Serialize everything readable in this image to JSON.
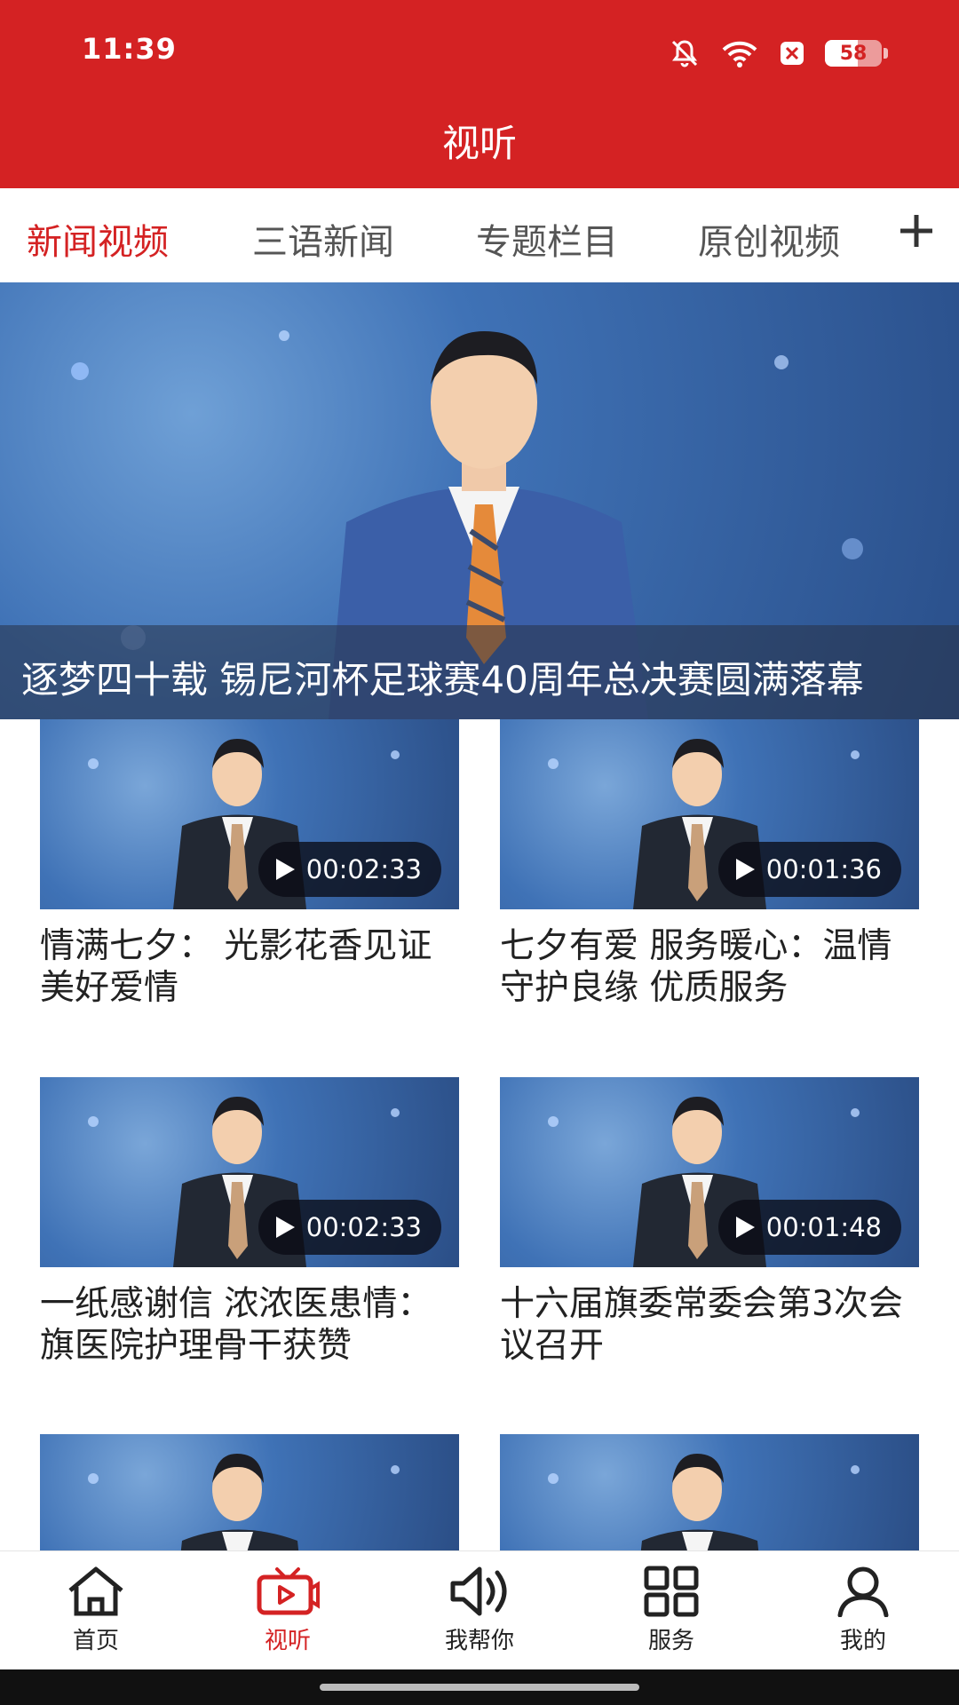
{
  "status_bar": {
    "time": "11:39",
    "battery": "58",
    "battery_level": 0.58
  },
  "header": {
    "title": "视听"
  },
  "tabs": [
    {
      "label": "新闻视频",
      "active": true
    },
    {
      "label": "三语新闻",
      "active": false
    },
    {
      "label": "专题栏目",
      "active": false
    },
    {
      "label": "原创视频",
      "active": false
    }
  ],
  "tabs_add_icon": "plus-icon",
  "hero": {
    "caption": "逐梦四十载 锡尼河杯足球赛40周年总决赛圆满落幕"
  },
  "videos": [
    {
      "title": "情满七夕： 光影花香见证美好爱情",
      "duration": "00:02:33"
    },
    {
      "title": "七夕有爱 服务暖心：温情守护良缘 优质服务",
      "duration": "00:01:36"
    },
    {
      "title": "一纸感谢信 浓浓医患情：旗医院护理骨干获赞",
      "duration": "00:02:33"
    },
    {
      "title": "十六届旗委常委会第3次会议召开",
      "duration": "00:01:48"
    },
    {
      "title": "",
      "duration": ""
    },
    {
      "title": "",
      "duration": ""
    }
  ],
  "bottom_nav": [
    {
      "label": "首页",
      "icon": "home-icon",
      "active": false
    },
    {
      "label": "视听",
      "icon": "video-tv-icon",
      "active": true
    },
    {
      "label": "我帮你",
      "icon": "speaker-icon",
      "active": false
    },
    {
      "label": "服务",
      "icon": "grid-icon",
      "active": false
    },
    {
      "label": "我的",
      "icon": "user-icon",
      "active": false
    }
  ],
  "colors": {
    "brand_red": "#D42223",
    "text_dark": "#222222",
    "text_gray": "#555555"
  }
}
